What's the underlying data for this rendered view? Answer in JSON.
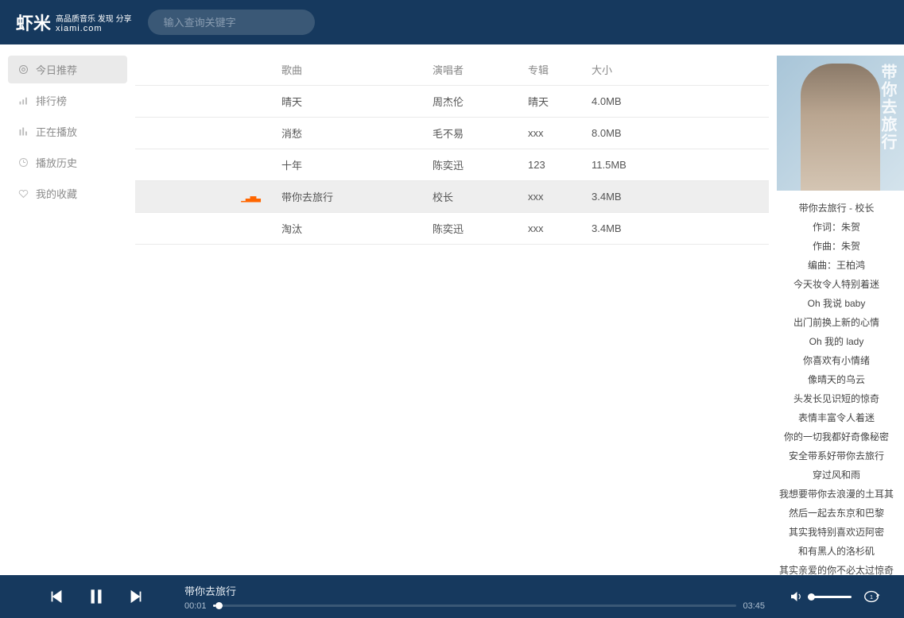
{
  "logo": {
    "main": "虾米",
    "tagline": "高品质音乐 发现 分享",
    "domain": "xiami.com"
  },
  "search": {
    "placeholder": "输入查询关键字"
  },
  "sidebar": {
    "items": [
      {
        "label": "今日推荐"
      },
      {
        "label": "排行榜"
      },
      {
        "label": "正在播放"
      },
      {
        "label": "播放历史"
      },
      {
        "label": "我的收藏"
      }
    ]
  },
  "table": {
    "headers": {
      "song": "歌曲",
      "artist": "演唱者",
      "album": "专辑",
      "size": "大小"
    },
    "rows": [
      {
        "song": "晴天",
        "artist": "周杰伦",
        "album": "晴天",
        "size": "4.0MB",
        "playing": false
      },
      {
        "song": "消愁",
        "artist": "毛不易",
        "album": "xxx",
        "size": "8.0MB",
        "playing": false
      },
      {
        "song": "十年",
        "artist": "陈奕迅",
        "album": "123",
        "size": "11.5MB",
        "playing": false
      },
      {
        "song": "带你去旅行",
        "artist": "校长",
        "album": "xxx",
        "size": "3.4MB",
        "playing": true
      },
      {
        "song": "淘汰",
        "artist": "陈奕迅",
        "album": "xxx",
        "size": "3.4MB",
        "playing": false
      }
    ]
  },
  "nowPlaying": {
    "albumText": "带你去旅行",
    "lyrics": [
      "带你去旅行 - 校长",
      "作词：朱贺",
      "作曲：朱贺",
      "编曲：王柏鸿",
      "今天妆令人特别着迷",
      "Oh 我说 baby",
      "出门前换上新的心情",
      "Oh 我的 lady",
      "你喜欢有小情绪",
      "像晴天的乌云",
      "头发长见识短的惊奇",
      "表情丰富令人着迷",
      "你的一切我都好奇像秘密",
      "安全带系好带你去旅行",
      "穿过风和雨",
      "我想要带你去浪漫的土耳其",
      "然后一起去东京和巴黎",
      "其实我特别喜欢迈阿密",
      "和有黑人的洛杉矶",
      "其实亲爱的你不必太过惊奇"
    ]
  },
  "player": {
    "title": "带你去旅行",
    "currentTime": "00:01",
    "totalTime": "03:45"
  }
}
